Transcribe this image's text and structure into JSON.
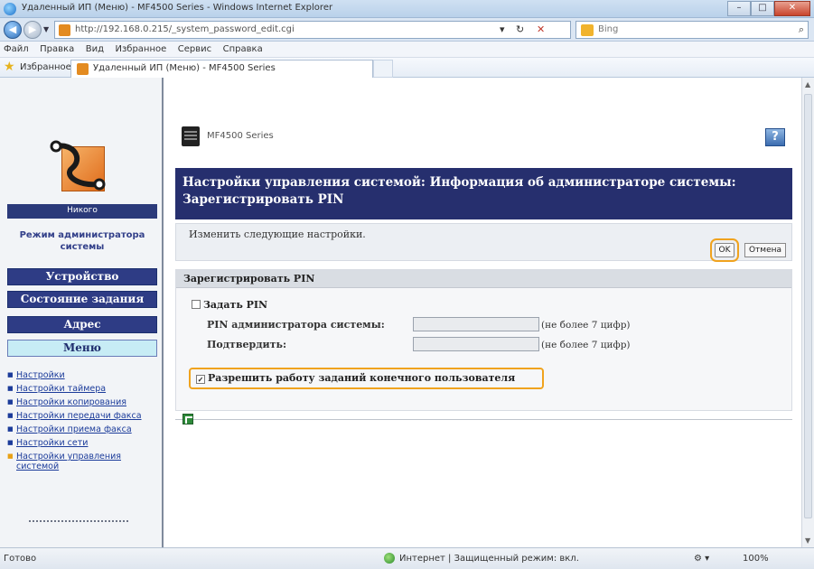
{
  "browser": {
    "window_title": "Удаленный ИП (Меню) - MF4500 Series - Windows Internet Explorer",
    "url": "http://192.168.0.215/_system_password_edit.cgi",
    "search_placeholder": "Bing",
    "menu": [
      "Файл",
      "Правка",
      "Вид",
      "Избранное",
      "Сервис",
      "Справка"
    ],
    "favorites_label": "Избранное",
    "tab_title": "Удаленный ИП (Меню) - MF4500 Series",
    "status_left": "Готово",
    "status_zone": "Интернет | Защищенный режим: вкл.",
    "zoom": "100%"
  },
  "sidebar": {
    "user_label": "Никого",
    "admin_mode": "Режим администратора системы",
    "buttons": [
      {
        "label": "Устройство"
      },
      {
        "label": "Состояние задания"
      },
      {
        "label": "Адрес"
      },
      {
        "label": "Меню"
      }
    ],
    "links": [
      {
        "label": "Настройки"
      },
      {
        "label": "Настройки таймера"
      },
      {
        "label": "Настройки копирования"
      },
      {
        "label": "Настройки передачи факса"
      },
      {
        "label": "Настройки приема факса"
      },
      {
        "label": "Настройки сети"
      },
      {
        "label": "Настройки управления системой"
      }
    ]
  },
  "main": {
    "device_name": "MF4500 Series",
    "help_label": "?",
    "title": "Настройки управления системой: Информация об администраторе системы: Зарегистрировать PIN",
    "change_message": "Изменить следующие настройки.",
    "ok_label": "OK",
    "cancel_label": "Отмена",
    "section_title": "Зарегистрировать PIN",
    "set_pin_label": "Задать PIN",
    "admin_pin_label": "PIN администратора системы:",
    "confirm_label": "Подтвердить:",
    "hint": "(не более 7 цифр)",
    "allow_label": "Разрешить работу заданий конечного пользователя"
  },
  "colors": {
    "banner": "#262f6e",
    "highlight": "#f0a31e",
    "nav_dark": "#2e3c85",
    "nav_light": "#c7ecf5"
  }
}
